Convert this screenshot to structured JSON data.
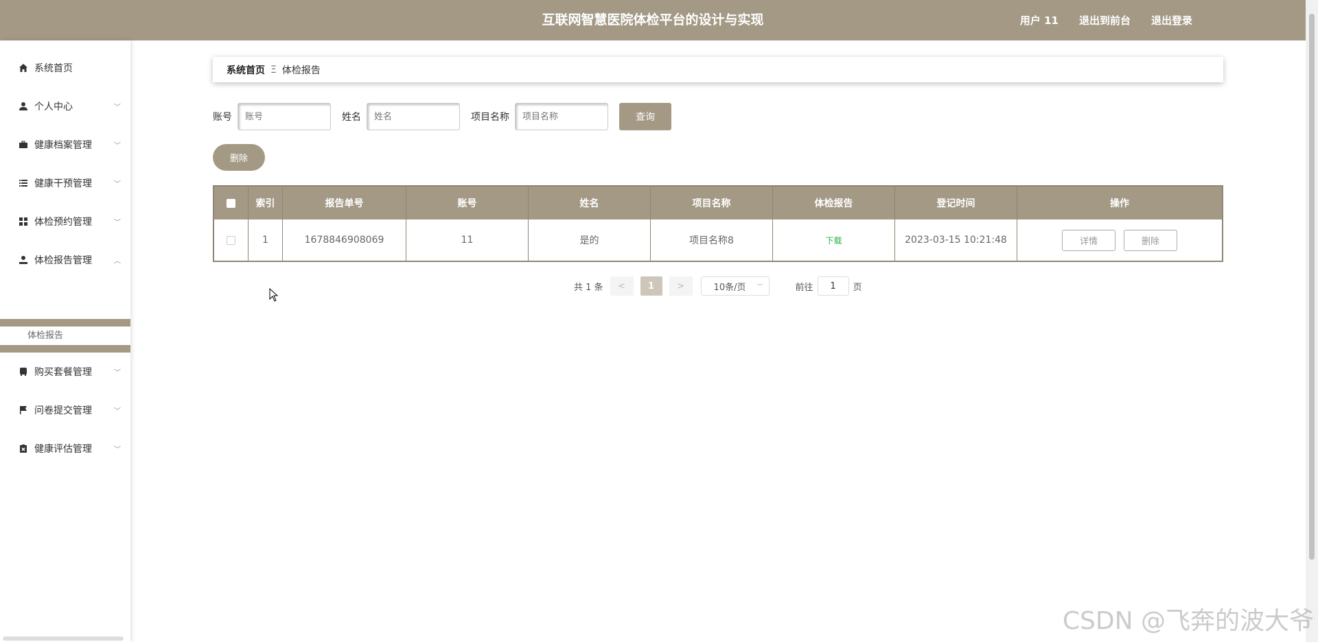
{
  "header": {
    "title": "互联网智慧医院体检平台的设计与实现",
    "user": "用户 11",
    "to_front": "退出到前台",
    "logout": "退出登录"
  },
  "sidebar": {
    "items": [
      {
        "label": "系统首页",
        "icon": "home-icon"
      },
      {
        "label": "个人中心",
        "icon": "user-icon"
      },
      {
        "label": "健康档案管理",
        "icon": "briefcase-icon"
      },
      {
        "label": "健康干预管理",
        "icon": "list-icon"
      },
      {
        "label": "体检预约管理",
        "icon": "grid-icon"
      },
      {
        "label": "体检报告管理",
        "icon": "user-icon"
      },
      {
        "label": "购买套餐管理",
        "icon": "bus-icon"
      },
      {
        "label": "问卷提交管理",
        "icon": "flag-icon"
      },
      {
        "label": "健康评估管理",
        "icon": "clipboard-icon"
      }
    ],
    "submenu_item": "体检报告"
  },
  "breadcrumb": {
    "home": "系统首页",
    "separator": "Ξ",
    "current": "体检报告"
  },
  "search": {
    "account_label": "账号",
    "account_placeholder": "账号",
    "name_label": "姓名",
    "name_placeholder": "姓名",
    "project_label": "项目名称",
    "project_placeholder": "项目名称",
    "query_button": "查询"
  },
  "delete_button": "删除",
  "table": {
    "headers": [
      "索引",
      "报告单号",
      "账号",
      "姓名",
      "项目名称",
      "体检报告",
      "登记时间",
      "操作"
    ],
    "rows": [
      {
        "index": "1",
        "report_no": "1678846908069",
        "account": "11",
        "name": "是的",
        "project": "项目名称8",
        "report": "下载",
        "time": "2023-03-15 10:21:48",
        "detail": "详情",
        "delete": "删除"
      }
    ]
  },
  "pagination": {
    "total": "共 1 条",
    "prev": "<",
    "current": "1",
    "next": ">",
    "page_size": "10条/页",
    "goto_label": "前往",
    "goto_value": "1",
    "page_unit": "页"
  },
  "watermark": "CSDN @飞奔的波大爷",
  "colors": {
    "primary": "#a39985",
    "download": "#2cb14e"
  }
}
